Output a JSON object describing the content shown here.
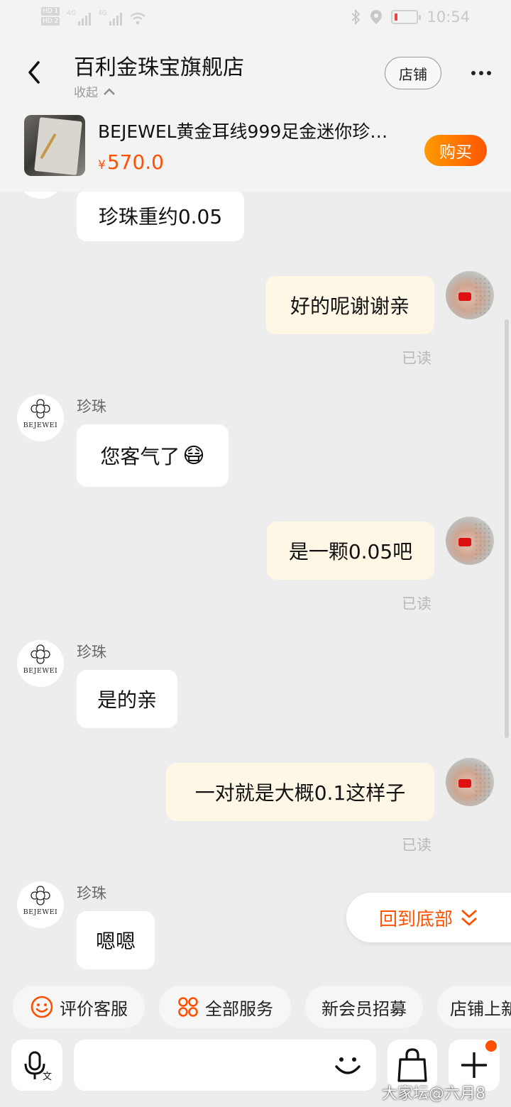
{
  "status_bar": {
    "network_badges": [
      "HD 1",
      "HD 2"
    ],
    "network_type": [
      "4G",
      "4G"
    ],
    "time": "10:54"
  },
  "header": {
    "title": "百利金珠宝旗舰店",
    "collapse_label": "收起",
    "store_button": "店铺",
    "icons": [
      "back-arrow-icon",
      "chevron-up-icon",
      "more-dots-icon"
    ]
  },
  "product": {
    "name": "BEJEWEL黄金耳线999足金迷你珍…",
    "currency": "¥",
    "price": "570.0",
    "buy_label": "购买"
  },
  "chat": {
    "store_avatar_brand": "BEJEWEI",
    "messages": [
      {
        "side": "in",
        "text": "珍珠重约0.05"
      },
      {
        "side": "out",
        "text": "好的呢谢谢亲",
        "status": "已读"
      },
      {
        "side": "in",
        "sender": "珍珠",
        "text": "您客气了",
        "emoji": "😷"
      },
      {
        "side": "out",
        "text": "是一颗0.05吧",
        "status": "已读"
      },
      {
        "side": "in",
        "sender": "珍珠",
        "text": "是的亲"
      },
      {
        "side": "out",
        "text": "一对就是大概0.1这样子",
        "status": "已读"
      },
      {
        "side": "in",
        "sender": "珍珠",
        "text": "嗯嗯"
      }
    ],
    "back_to_bottom": "回到底部"
  },
  "quick_services": [
    {
      "label": "评价客服",
      "icon": "smile-icon"
    },
    {
      "label": "全部服务",
      "icon": "grid-icon"
    },
    {
      "label": "新会员招募"
    },
    {
      "label": "店铺上新"
    }
  ],
  "input_bar": {
    "voice_icon": "microphone-translate-icon",
    "emoji_icon": "smiley-icon",
    "bag_icon": "shopping-bag-icon",
    "plus_icon": "plus-icon"
  },
  "watermark": "大家坛@六月8",
  "colors": {
    "accent": "#ff5000",
    "background": "#ededed",
    "outgoing_bubble": "#fef7e6",
    "incoming_bubble": "#ffffff"
  }
}
